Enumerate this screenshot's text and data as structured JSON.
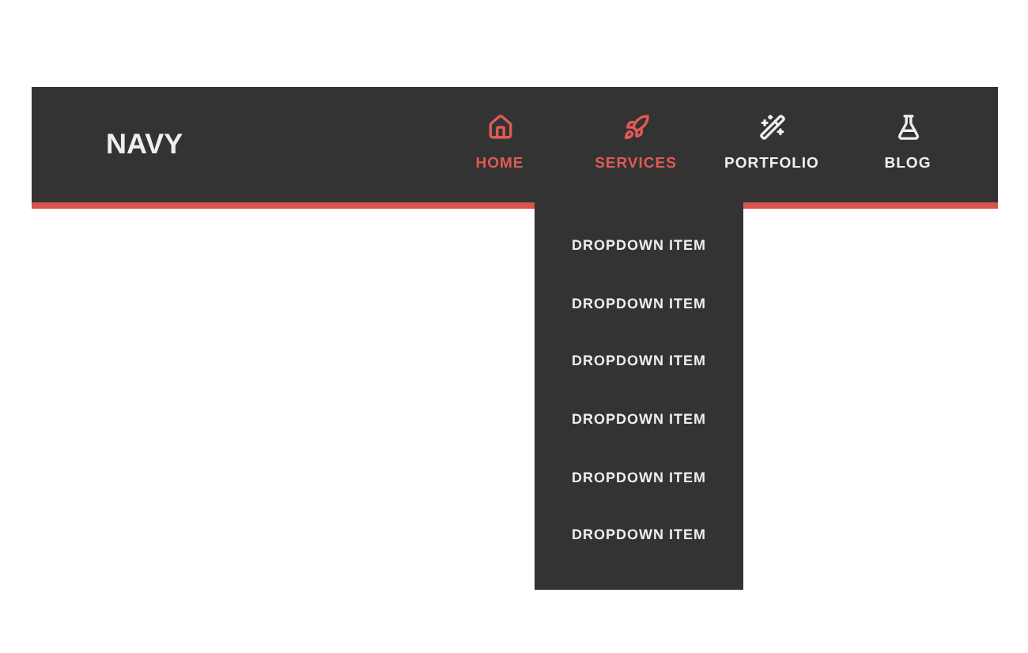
{
  "logo": "NAVY",
  "nav_items": [
    {
      "label": "HOME",
      "selected": true,
      "expanded": false
    },
    {
      "label": "SERVICES",
      "selected": true,
      "expanded": true,
      "dropdown": [
        "DROPDOWN ITEM",
        "DROPDOWN ITEM",
        "DROPDOWN ITEM",
        "DROPDOWN ITEM",
        "DROPDOWN ITEM",
        "DROPDOWN ITEM"
      ]
    },
    {
      "label": "PORTFOLIO",
      "selected": false,
      "expanded": false
    },
    {
      "label": "BLOG",
      "selected": false,
      "expanded": false
    }
  ]
}
